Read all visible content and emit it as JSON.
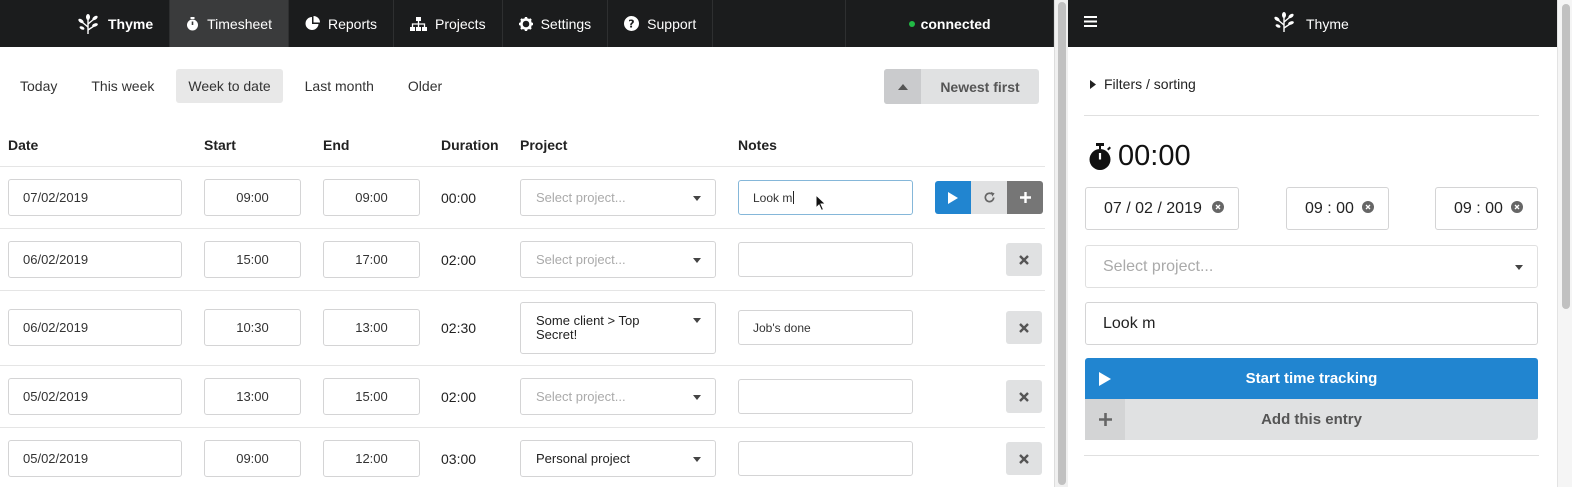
{
  "app": {
    "brand": "Thyme",
    "nav": [
      {
        "label": "Timesheet",
        "icon": "stopwatch-icon",
        "active": true
      },
      {
        "label": "Reports",
        "icon": "pie-chart-icon",
        "active": false
      },
      {
        "label": "Projects",
        "icon": "sitemap-icon",
        "active": false
      },
      {
        "label": "Settings",
        "icon": "gear-icon",
        "active": false
      },
      {
        "label": "Support",
        "icon": "question-circle-icon",
        "active": false
      }
    ],
    "status": "connected",
    "status_color": "#21ba45"
  },
  "periods": [
    {
      "label": "Today",
      "active": false
    },
    {
      "label": "This week",
      "active": false
    },
    {
      "label": "Week to date",
      "active": true
    },
    {
      "label": "Last month",
      "active": false
    },
    {
      "label": "Older",
      "active": false
    }
  ],
  "sort_button": {
    "label": "Newest first",
    "icon": "triangle-up-icon"
  },
  "table": {
    "headers": {
      "date": "Date",
      "start": "Start",
      "end": "End",
      "duration": "Duration",
      "project": "Project",
      "notes": "Notes"
    },
    "rows": [
      {
        "date": "07/02/2019",
        "start": "09:00",
        "end": "09:00",
        "duration": "00:00",
        "project": "",
        "project_placeholder": "Select project...",
        "notes": "Look m"
      },
      {
        "date": "06/02/2019",
        "start": "15:00",
        "end": "17:00",
        "duration": "02:00",
        "project": "",
        "project_placeholder": "Select project...",
        "notes": ""
      },
      {
        "date": "06/02/2019",
        "start": "10:30",
        "end": "13:00",
        "duration": "02:30",
        "project": "Some client > Top Secret!",
        "project_placeholder": "",
        "notes": "Job's done"
      },
      {
        "date": "05/02/2019",
        "start": "13:00",
        "end": "15:00",
        "duration": "02:00",
        "project": "",
        "project_placeholder": "Select project...",
        "notes": ""
      },
      {
        "date": "05/02/2019",
        "start": "09:00",
        "end": "12:00",
        "duration": "03:00",
        "project": "Personal project",
        "project_placeholder": "",
        "notes": ""
      }
    ]
  },
  "colors": {
    "primary": "#2185d0",
    "nav_bg": "#1b1c1d"
  },
  "panel": {
    "brand": "Thyme",
    "filters_label": "Filters / sorting",
    "timer": "00:00",
    "date": "07 / 02 / 2019",
    "start": "09 : 00",
    "end": "09 : 00",
    "project_placeholder": "Select project...",
    "notes": "Look m",
    "start_button": "Start time tracking",
    "add_button": "Add this entry"
  }
}
